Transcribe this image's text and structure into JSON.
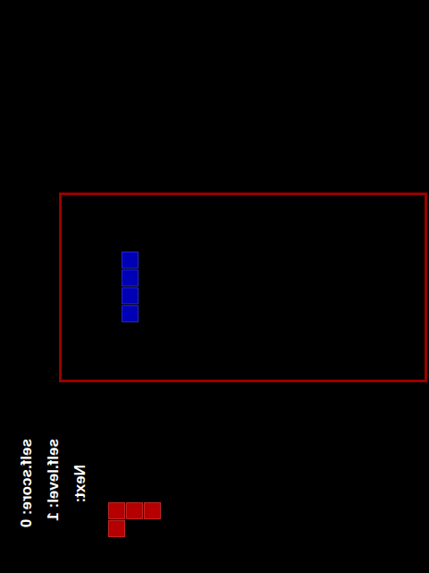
{
  "hud": {
    "score": "self.score: 0",
    "level": "self.level: 1",
    "next_label": "Next:"
  },
  "board": {
    "current_piece": {
      "color": "#0000b4",
      "cells": [
        {
          "col": 3,
          "row": 3
        },
        {
          "col": 3,
          "row": 4
        },
        {
          "col": 3,
          "row": 5
        },
        {
          "col": 3,
          "row": 6
        }
      ]
    }
  },
  "next_piece": {
    "color": "#b40000",
    "cells": [
      {
        "col": 0,
        "row": 0
      },
      {
        "col": 1,
        "row": 0
      },
      {
        "col": 2,
        "row": 0
      },
      {
        "col": 0,
        "row": 1
      }
    ]
  }
}
